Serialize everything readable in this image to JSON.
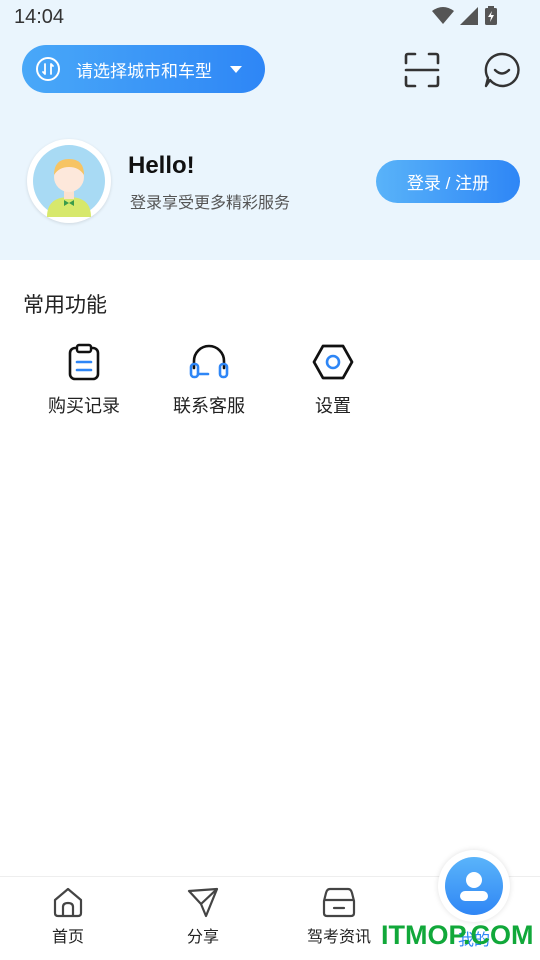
{
  "status_bar": {
    "time": "14:04",
    "icons": [
      "wifi-icon",
      "signal-icon",
      "battery-icon"
    ]
  },
  "header": {
    "city_selector": {
      "label": "请选择城市和车型",
      "icon": "swap-icon"
    },
    "scan_icon": "scan-icon",
    "message_icon": "chat-icon"
  },
  "profile": {
    "greeting": "Hello!",
    "subtitle": "登录享受更多精彩服务",
    "login_label": "登录 / 注册"
  },
  "common_functions": {
    "title": "常用功能",
    "items": [
      {
        "label": "购买记录",
        "icon": "clipboard-icon"
      },
      {
        "label": "联系客服",
        "icon": "headset-icon"
      },
      {
        "label": "设置",
        "icon": "hexagon-settings-icon"
      }
    ]
  },
  "bottom_nav": {
    "items": [
      {
        "label": "首页",
        "icon": "home-icon"
      },
      {
        "label": "分享",
        "icon": "paper-plane-icon"
      },
      {
        "label": "驾考资讯",
        "icon": "car-icon"
      },
      {
        "label": "我的",
        "icon": "user-icon",
        "active": true
      }
    ]
  },
  "watermark": "ITMOP.COM",
  "colors": {
    "accent": "#2e86f6",
    "header_bg": "#eaf5fd",
    "watermark": "#11a83a"
  }
}
